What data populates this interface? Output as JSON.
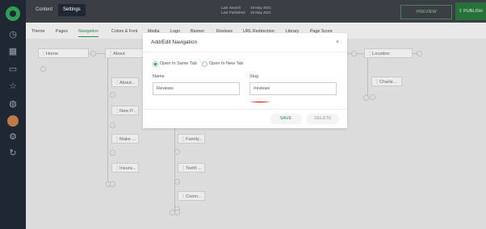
{
  "topbar": {
    "content_tab": "Content",
    "settings_tab": "Settings",
    "last_search_label": "Last Search",
    "last_search_value": "19 May 2021",
    "last_published_label": "Last Published",
    "last_published_value": "19 May 2021",
    "preview_label": "PREVIEW",
    "publish_label": "PUBLISH"
  },
  "settings_tabs": [
    "Theme",
    "Pages",
    "Navigation",
    "Colors & Font",
    "Media",
    "Logo",
    "Banner",
    "Reviews",
    "URL Redirection",
    "Library",
    "Page Score"
  ],
  "nav_nodes": {
    "home": "Home",
    "about": "About",
    "location": "Location",
    "about_child": "About...",
    "new_p": "New P...",
    "make": "Make ...",
    "insura": "Insura...",
    "family": "Family...",
    "teeth": "Teeth ...",
    "coom": "Coom...",
    "charle": "Charle..."
  },
  "modal": {
    "title": "Add/Edit Navigation",
    "close": "×",
    "radio_same_tab": "Open In Same Tab",
    "radio_new_tab": "Open In New Tab",
    "name_label": "Name",
    "name_value": "Reviews",
    "slug_label": "Slug",
    "slug_value": "/reviews",
    "save_label": "SAVE",
    "delete_label": "DELETE"
  },
  "colors": {
    "accent": "#2d8a4c",
    "sidebar": "#1f2733",
    "topbar": "#3b3f45"
  }
}
